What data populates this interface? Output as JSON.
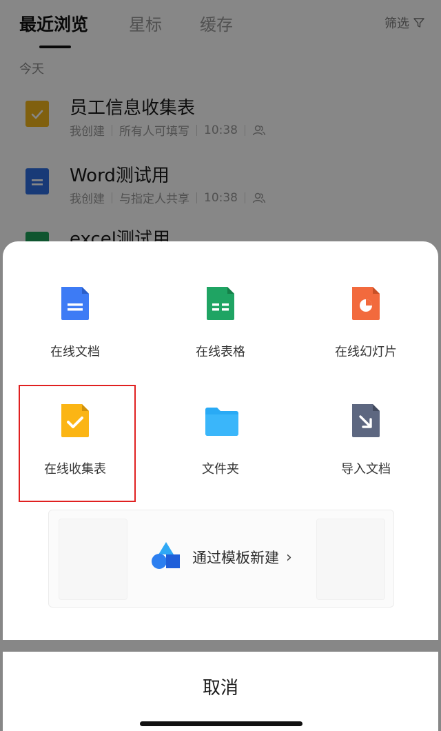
{
  "tabs": [
    {
      "label": "最近浏览",
      "active": true
    },
    {
      "label": "星标",
      "active": false
    },
    {
      "label": "缓存",
      "active": false
    }
  ],
  "filter_label": "筛选",
  "section_label": "今天",
  "files": [
    {
      "title": "员工信息收集表",
      "creator": "我创建",
      "permission": "所有人可填写",
      "time": "10:38",
      "icon": "form-icon",
      "color": "#f2b61b"
    },
    {
      "title": "Word测试用",
      "creator": "我创建",
      "permission": "与指定人共享",
      "time": "10:38",
      "icon": "doc-icon",
      "color": "#2e6fe0"
    },
    {
      "title": "excel测试用",
      "icon": "sheet-icon",
      "color": "#1ea05a"
    }
  ],
  "create_options": [
    {
      "label": "在线文档",
      "icon": "online-doc-icon",
      "color": "#3d7bf5"
    },
    {
      "label": "在线表格",
      "icon": "online-sheet-icon",
      "color": "#1fa463"
    },
    {
      "label": "在线幻灯片",
      "icon": "online-slide-icon",
      "color": "#f26a3d"
    },
    {
      "label": "在线收集表",
      "icon": "online-form-icon",
      "color": "#fbb514",
      "highlighted": true
    },
    {
      "label": "文件夹",
      "icon": "folder-icon",
      "color": "#29aaf5"
    },
    {
      "label": "导入文档",
      "icon": "import-doc-icon",
      "color": "#5d6780"
    }
  ],
  "template": {
    "label": "通过模板新建",
    "arrow": "›"
  },
  "cancel_label": "取消"
}
